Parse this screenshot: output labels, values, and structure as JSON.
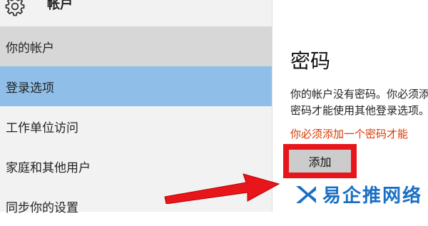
{
  "header": {
    "title": "帐户",
    "icon": "gear-icon"
  },
  "sidebar": {
    "items": [
      {
        "label": "你的帐户"
      },
      {
        "label": "登录选项"
      },
      {
        "label": "工作单位访问"
      },
      {
        "label": "家庭和其他用户"
      },
      {
        "label": "同步你的设置"
      }
    ]
  },
  "main": {
    "section_title": "密码",
    "description": "你的帐户没有密码。你必须添加一个密码才能使用其他登录选项。",
    "warning": "你必须添加一个密码才能",
    "add_button": "添加"
  },
  "colors": {
    "active": "#8fbfe8",
    "warning": "#d83b01",
    "highlight": "#e8161b"
  },
  "watermark": {
    "text": "易企推网络"
  }
}
